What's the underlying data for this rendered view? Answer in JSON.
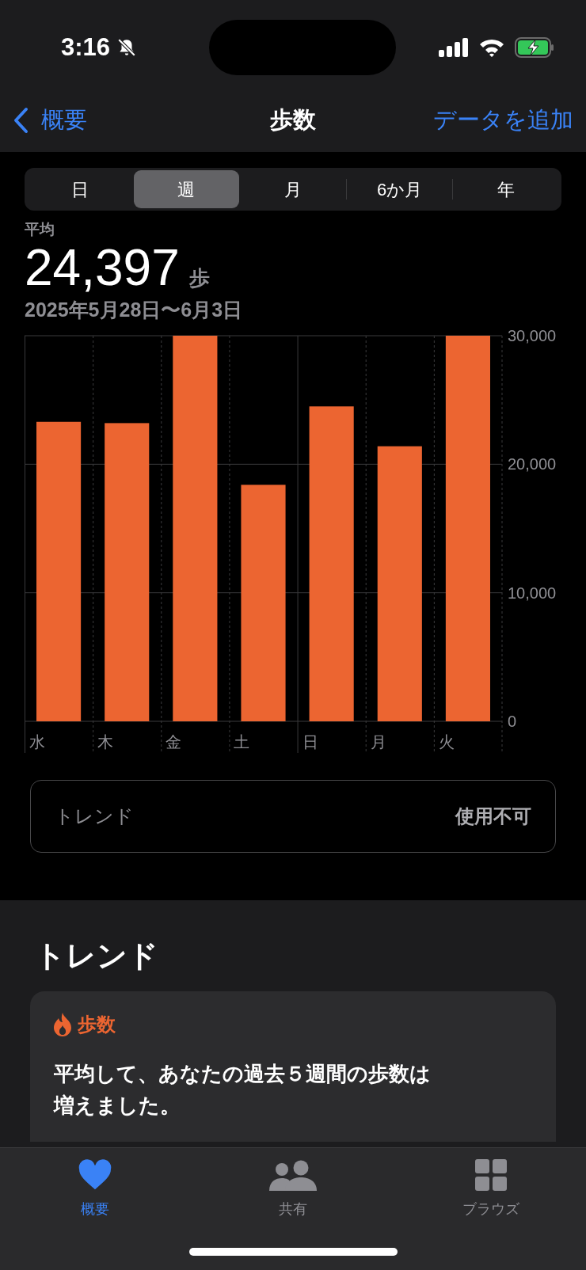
{
  "status_bar": {
    "time": "3:16",
    "silent": true
  },
  "nav": {
    "back": "概要",
    "title": "歩数",
    "action": "データを追加"
  },
  "segments": [
    {
      "label": "日",
      "selected": false
    },
    {
      "label": "週",
      "selected": true
    },
    {
      "label": "月",
      "selected": false
    },
    {
      "label": "6か月",
      "selected": false
    },
    {
      "label": "年",
      "selected": false
    }
  ],
  "summary": {
    "label": "平均",
    "value": "24,397",
    "unit": "歩",
    "range": "2025年5月28日〜6月3日"
  },
  "chart": {
    "chart_data": {
      "type": "bar",
      "categories": [
        "水",
        "木",
        "金",
        "土",
        "日",
        "月",
        "火"
      ],
      "series": [
        {
          "color": "#ec6531",
          "values": [
            23300,
            23200,
            30000,
            18400,
            24500,
            21400,
            30000
          ]
        }
      ],
      "ylim": [
        0,
        30000
      ],
      "yticks": [
        {
          "value": 0,
          "label": "0"
        },
        {
          "value": 10000,
          "label": "10,000"
        },
        {
          "value": 20000,
          "label": "20,000"
        },
        {
          "value": 30000,
          "label": "30,000"
        }
      ]
    }
  },
  "trend_row": {
    "label": "トレンド",
    "value": "使用不可"
  },
  "trends": {
    "heading": "トレンド",
    "card": {
      "title": "歩数",
      "text": "平均して、あなたの過去５週間の歩数は増えました。"
    }
  },
  "tab_bar": [
    {
      "label": "概要",
      "kind": "heart",
      "selected": true
    },
    {
      "label": "共有",
      "kind": "people",
      "selected": false
    },
    {
      "label": "ブラウズ",
      "kind": "grid",
      "selected": false
    }
  ]
}
